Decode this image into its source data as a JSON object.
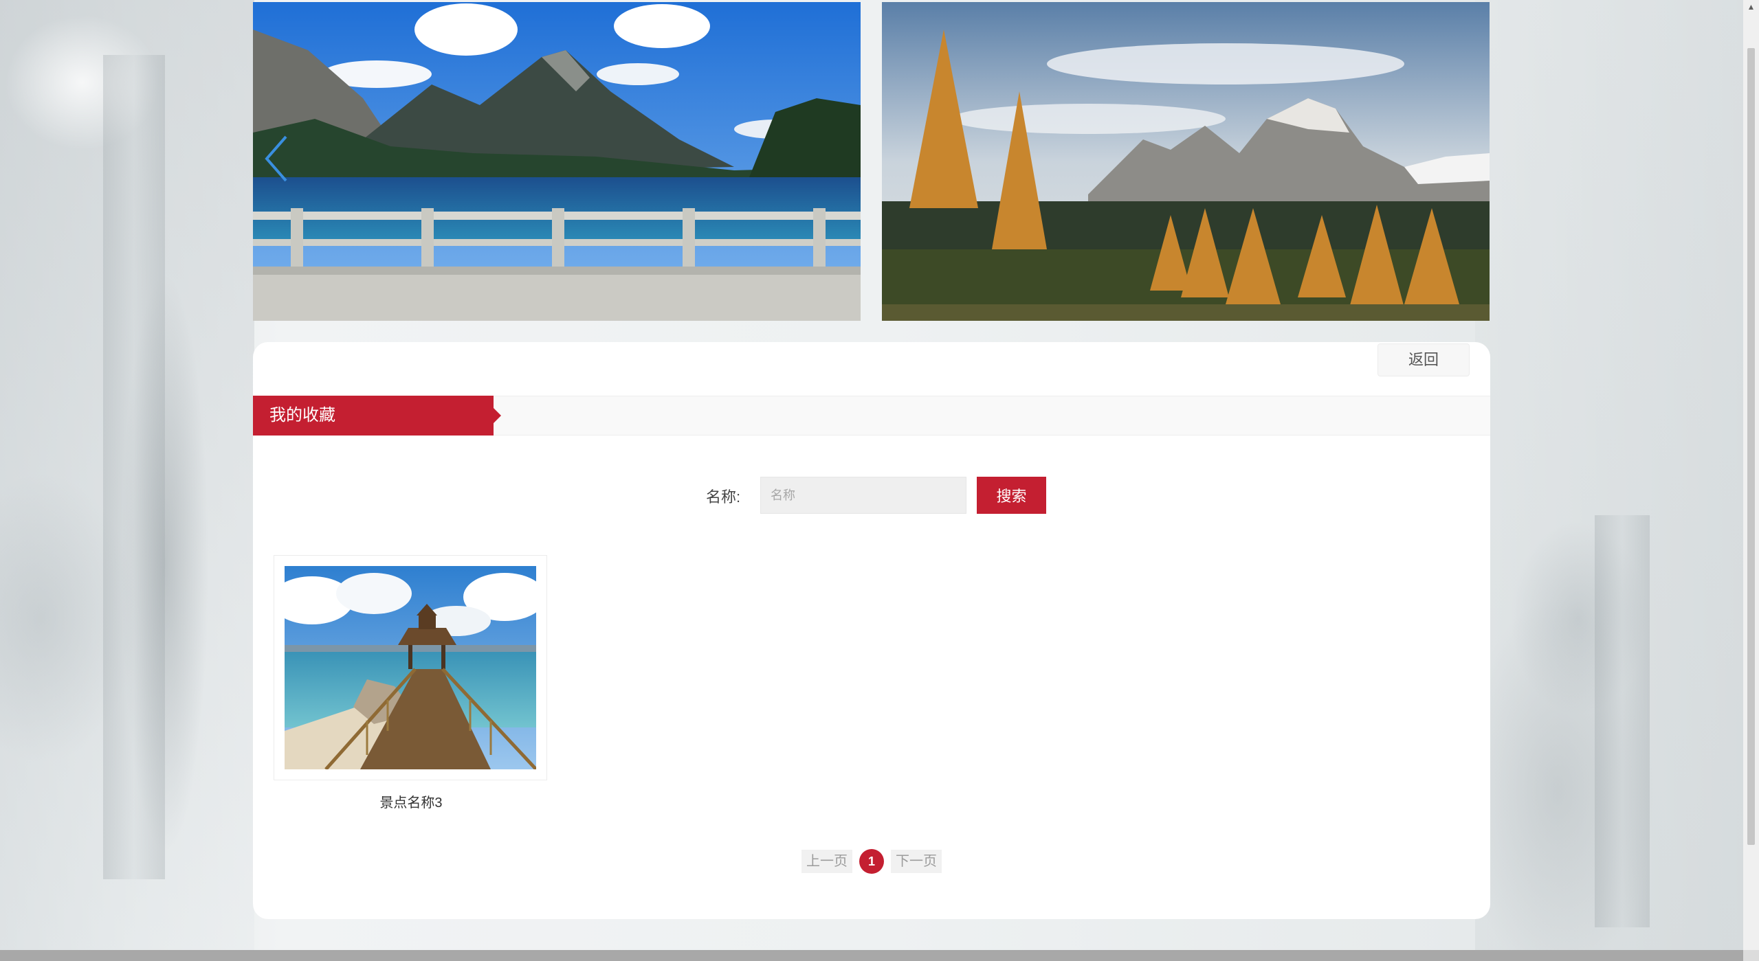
{
  "banner": {
    "prev_icon": "chevron-left-icon",
    "slides": [
      {
        "scene": "mountain-lake-bridge"
      },
      {
        "scene": "autumn-larches-mountains"
      }
    ]
  },
  "header": {
    "back_label": "返回"
  },
  "section": {
    "title": "我的收藏"
  },
  "search": {
    "label": "名称:",
    "placeholder": "名称",
    "value": "",
    "button_label": "搜索"
  },
  "favorites": [
    {
      "name": "景点名称3",
      "image": "pier-pavilion-sea"
    }
  ],
  "pagination": {
    "prev_label": "上一页",
    "current_page": "1",
    "next_label": "下一页"
  },
  "colors": {
    "accent": "#c41f31",
    "panel": "#ffffff"
  }
}
